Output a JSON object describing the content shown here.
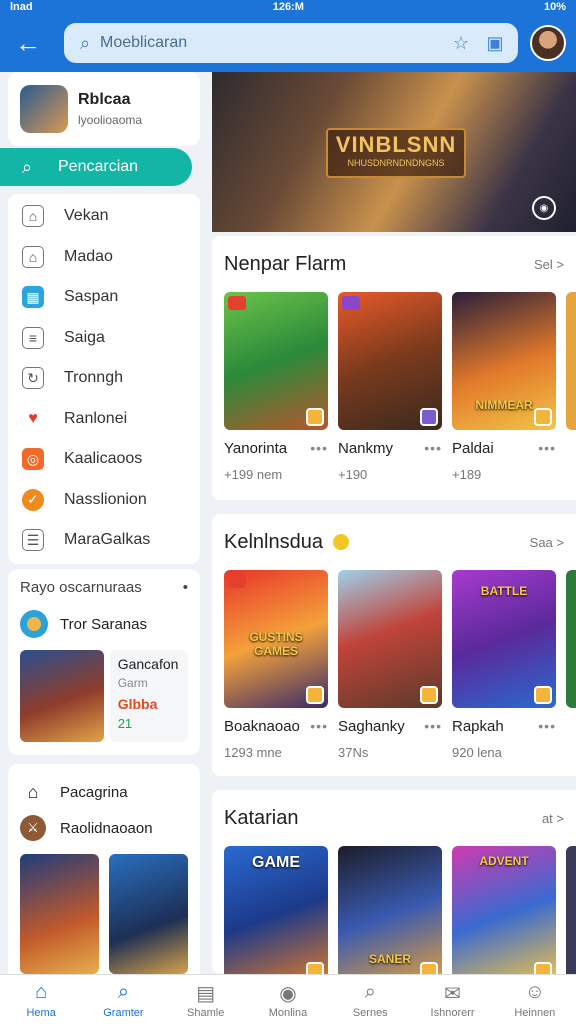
{
  "status": {
    "left": "lnad",
    "time": "126:M",
    "battery": "10%"
  },
  "search": {
    "placeholder": "Moeblicaran"
  },
  "profile": {
    "name": "Rblcaa",
    "sub": "lyoolioaoma"
  },
  "sidebar": {
    "active_label": "Pencarcian",
    "items": [
      {
        "label": "Vekan",
        "icon": "bookmark-icon"
      },
      {
        "label": "Madao",
        "icon": "home-icon"
      },
      {
        "label": "Saspan",
        "icon": "store-icon"
      },
      {
        "label": "Saiga",
        "icon": "news-icon"
      },
      {
        "label": "Tronngh",
        "icon": "refresh-icon"
      },
      {
        "label": "Ranlonei",
        "icon": "flame-icon"
      },
      {
        "label": "Kaalicaoos",
        "icon": "orange-app-icon"
      },
      {
        "label": "Nasslionion",
        "icon": "check-icon"
      },
      {
        "label": "MaraGalkas",
        "icon": "list-icon"
      }
    ]
  },
  "yt_card": {
    "header": "Rayo oscarnuraas",
    "row": "Tror Saranas",
    "feature": {
      "title": "Gancafon",
      "sub": "Garm",
      "price": "Glbba",
      "count": "21"
    }
  },
  "p_card": {
    "row1": "Pacagrina",
    "row2": "Raolidnaoaon"
  },
  "banner": {
    "title": "VINBLSNN",
    "subtitle": "NHUSDNRNDNDNGNS"
  },
  "sections": [
    {
      "title": "Nenpar Flarm",
      "more": "Sel >",
      "items": [
        {
          "name": "Yanorinta",
          "count": "+199 nem",
          "label": ""
        },
        {
          "name": "Nankmy",
          "count": "+190",
          "label": ""
        },
        {
          "name": "Paldai",
          "count": "+189",
          "label": "NIMMEAR"
        }
      ]
    },
    {
      "title": "Kelnlnsdua",
      "more": "Saa >",
      "items": [
        {
          "name": "Boaknaoao",
          "count": "1293 mne",
          "label": "GUSTINS GAMES"
        },
        {
          "name": "Saghanky",
          "count": "37Ns",
          "label": ""
        },
        {
          "name": "Rapkah",
          "count": "920 lena",
          "label": "BATTLE"
        }
      ]
    },
    {
      "title": "Katarian",
      "more": "at >",
      "items": [
        {
          "label": "GAME"
        },
        {
          "label": "SANER"
        },
        {
          "label": "ADVENT"
        }
      ]
    }
  ],
  "bottom_nav": [
    {
      "label": "Hema",
      "icon": "home-icon"
    },
    {
      "label": "Gramter",
      "icon": "search-icon"
    },
    {
      "label": "Shamle",
      "icon": "cart-icon"
    },
    {
      "label": "Monlina",
      "icon": "compass-icon"
    },
    {
      "label": "Sernes",
      "icon": "search-icon"
    },
    {
      "label": "Ishnorerr",
      "icon": "mail-icon"
    },
    {
      "label": "Heinnen",
      "icon": "profile-icon"
    }
  ]
}
